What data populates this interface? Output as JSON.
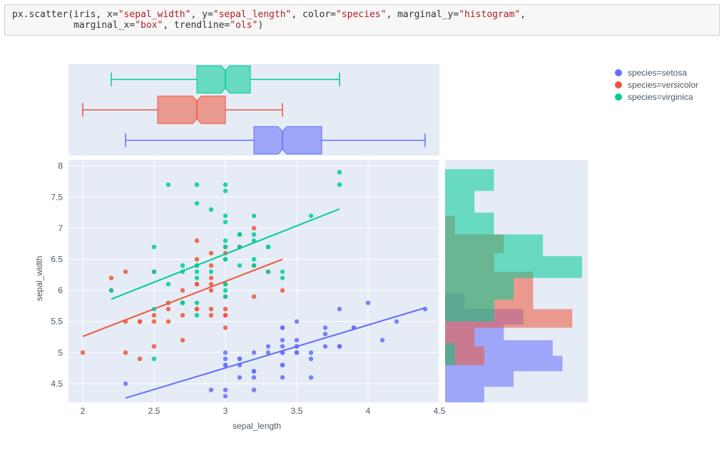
{
  "code_cell": {
    "tokens": [
      {
        "t": "px.scatter(iris, x=",
        "cls": "fn"
      },
      {
        "t": "\"sepal_width\"",
        "cls": "str"
      },
      {
        "t": ", y=",
        "cls": "fn"
      },
      {
        "t": "\"sepal_length\"",
        "cls": "str"
      },
      {
        "t": ", color=",
        "cls": "fn"
      },
      {
        "t": "\"species\"",
        "cls": "str"
      },
      {
        "t": ", marginal_y=",
        "cls": "fn"
      },
      {
        "t": "\"histogram\"",
        "cls": "str"
      },
      {
        "t": ",\n           marginal_x=",
        "cls": "fn"
      },
      {
        "t": "\"box\"",
        "cls": "str"
      },
      {
        "t": ", trendline=",
        "cls": "fn"
      },
      {
        "t": "\"ols\"",
        "cls": "str"
      },
      {
        "t": ")",
        "cls": "fn"
      }
    ]
  },
  "legend": {
    "items": [
      {
        "label": "species=setosa",
        "color": "#636efa"
      },
      {
        "label": "species=versicolor",
        "color": "#EF553B"
      },
      {
        "label": "species=virginica",
        "color": "#00cc96"
      }
    ]
  },
  "axes": {
    "xlabel": "sepal_length",
    "ylabel": "sepal_width",
    "xticks": [
      2,
      2.5,
      3,
      3.5,
      4,
      4.5
    ],
    "yticks": [
      4.5,
      5,
      5.5,
      6,
      6.5,
      7,
      7.5,
      8
    ],
    "xlim": [
      1.9,
      4.5
    ],
    "ylim": [
      4.2,
      8.1
    ]
  },
  "colors": {
    "setosa": "#636efa",
    "versicolor": "#EF553B",
    "virginica": "#00cc96"
  },
  "chart_data": {
    "type": "scatter",
    "xlabel": "sepal_width",
    "ylabel": "sepal_length",
    "series": [
      {
        "name": "setosa",
        "color": "#636efa",
        "points": [
          [
            3.5,
            5.1
          ],
          [
            3.0,
            4.9
          ],
          [
            3.2,
            4.7
          ],
          [
            3.1,
            4.6
          ],
          [
            3.6,
            5.0
          ],
          [
            3.9,
            5.4
          ],
          [
            3.4,
            4.6
          ],
          [
            3.4,
            5.0
          ],
          [
            2.9,
            4.4
          ],
          [
            3.1,
            4.9
          ],
          [
            3.7,
            5.4
          ],
          [
            3.4,
            4.8
          ],
          [
            3.0,
            4.8
          ],
          [
            3.0,
            4.3
          ],
          [
            4.0,
            5.8
          ],
          [
            4.4,
            5.7
          ],
          [
            3.9,
            5.4
          ],
          [
            3.5,
            5.1
          ],
          [
            3.8,
            5.7
          ],
          [
            3.8,
            5.1
          ],
          [
            3.4,
            5.4
          ],
          [
            3.7,
            5.1
          ],
          [
            3.6,
            4.6
          ],
          [
            3.3,
            5.1
          ],
          [
            3.4,
            4.8
          ],
          [
            3.0,
            5.0
          ],
          [
            3.4,
            5.0
          ],
          [
            3.5,
            5.2
          ],
          [
            3.4,
            5.2
          ],
          [
            3.2,
            4.7
          ],
          [
            3.1,
            4.8
          ],
          [
            3.4,
            5.4
          ],
          [
            4.1,
            5.2
          ],
          [
            4.2,
            5.5
          ],
          [
            3.1,
            4.9
          ],
          [
            3.2,
            5.0
          ],
          [
            3.5,
            5.5
          ],
          [
            3.6,
            4.9
          ],
          [
            3.0,
            4.4
          ],
          [
            3.4,
            5.1
          ],
          [
            3.5,
            5.0
          ],
          [
            2.3,
            4.5
          ],
          [
            3.2,
            4.4
          ],
          [
            3.5,
            5.0
          ],
          [
            3.8,
            5.1
          ],
          [
            3.0,
            4.8
          ],
          [
            3.8,
            5.1
          ],
          [
            3.2,
            4.6
          ],
          [
            3.7,
            5.3
          ],
          [
            3.3,
            5.0
          ]
        ],
        "trend": {
          "x0": 2.3,
          "y0": 4.27,
          "x1": 4.4,
          "y1": 5.72
        },
        "box": {
          "min": 2.3,
          "q1": 3.2,
          "med": 3.4,
          "q3": 3.675,
          "max": 4.4
        },
        "hist": {
          "bin_edges": [
            4.2,
            4.45,
            4.7,
            4.95,
            5.2,
            5.45,
            5.7,
            5.95
          ],
          "counts": [
            4,
            7,
            12,
            11,
            6,
            8,
            2
          ]
        }
      },
      {
        "name": "versicolor",
        "color": "#EF553B",
        "points": [
          [
            3.2,
            7.0
          ],
          [
            3.2,
            6.4
          ],
          [
            3.1,
            6.9
          ],
          [
            2.3,
            5.5
          ],
          [
            2.8,
            6.5
          ],
          [
            2.8,
            5.7
          ],
          [
            3.3,
            6.3
          ],
          [
            2.4,
            4.9
          ],
          [
            2.9,
            6.6
          ],
          [
            2.7,
            5.2
          ],
          [
            2.0,
            5.0
          ],
          [
            3.0,
            5.9
          ],
          [
            2.2,
            6.0
          ],
          [
            2.9,
            6.1
          ],
          [
            2.9,
            5.6
          ],
          [
            3.1,
            6.7
          ],
          [
            3.0,
            5.6
          ],
          [
            2.7,
            5.8
          ],
          [
            2.2,
            6.2
          ],
          [
            2.5,
            5.6
          ],
          [
            3.2,
            5.9
          ],
          [
            2.8,
            6.1
          ],
          [
            2.5,
            6.3
          ],
          [
            2.8,
            6.1
          ],
          [
            2.9,
            6.4
          ],
          [
            3.0,
            6.6
          ],
          [
            2.8,
            6.8
          ],
          [
            3.0,
            6.7
          ],
          [
            2.9,
            6.0
          ],
          [
            2.6,
            5.7
          ],
          [
            2.4,
            5.5
          ],
          [
            2.4,
            5.5
          ],
          [
            2.7,
            5.8
          ],
          [
            2.7,
            6.0
          ],
          [
            3.0,
            5.4
          ],
          [
            3.4,
            6.0
          ],
          [
            3.1,
            6.7
          ],
          [
            2.3,
            6.3
          ],
          [
            3.0,
            5.6
          ],
          [
            2.5,
            5.5
          ],
          [
            2.6,
            5.5
          ],
          [
            3.0,
            6.1
          ],
          [
            2.6,
            5.8
          ],
          [
            2.3,
            5.0
          ],
          [
            2.7,
            5.6
          ],
          [
            3.0,
            5.7
          ],
          [
            2.9,
            5.7
          ],
          [
            2.9,
            6.2
          ],
          [
            2.5,
            5.1
          ],
          [
            2.8,
            5.7
          ]
        ],
        "trend": {
          "x0": 2.0,
          "y0": 5.26,
          "x1": 3.4,
          "y1": 6.5
        },
        "box": {
          "min": 2.0,
          "q1": 2.525,
          "med": 2.8,
          "q3": 3.0,
          "max": 3.4
        },
        "hist": {
          "bin_edges": [
            4.8,
            5.1,
            5.4,
            5.7,
            6.0,
            6.3,
            6.6,
            6.9,
            7.2
          ],
          "counts": [
            4,
            3,
            13,
            9,
            9,
            5,
            6,
            1
          ]
        }
      },
      {
        "name": "virginica",
        "color": "#00cc96",
        "points": [
          [
            3.3,
            6.3
          ],
          [
            2.7,
            5.8
          ],
          [
            3.0,
            7.1
          ],
          [
            2.9,
            6.3
          ],
          [
            3.0,
            6.5
          ],
          [
            3.0,
            7.6
          ],
          [
            2.5,
            4.9
          ],
          [
            2.9,
            7.3
          ],
          [
            2.5,
            6.7
          ],
          [
            3.6,
            7.2
          ],
          [
            3.2,
            6.5
          ],
          [
            2.7,
            6.4
          ],
          [
            3.0,
            6.8
          ],
          [
            2.5,
            5.7
          ],
          [
            2.8,
            5.8
          ],
          [
            3.2,
            6.4
          ],
          [
            3.0,
            6.5
          ],
          [
            3.8,
            7.7
          ],
          [
            2.6,
            7.7
          ],
          [
            2.2,
            6.0
          ],
          [
            3.2,
            6.9
          ],
          [
            2.8,
            5.6
          ],
          [
            2.8,
            7.7
          ],
          [
            2.7,
            6.3
          ],
          [
            3.3,
            6.7
          ],
          [
            3.2,
            7.2
          ],
          [
            2.8,
            6.2
          ],
          [
            3.0,
            6.1
          ],
          [
            2.8,
            6.4
          ],
          [
            3.0,
            7.2
          ],
          [
            2.8,
            7.4
          ],
          [
            3.8,
            7.9
          ],
          [
            2.8,
            6.4
          ],
          [
            2.8,
            6.3
          ],
          [
            2.6,
            6.1
          ],
          [
            3.0,
            7.7
          ],
          [
            3.4,
            6.3
          ],
          [
            3.1,
            6.4
          ],
          [
            3.0,
            6.0
          ],
          [
            3.1,
            6.9
          ],
          [
            3.1,
            6.7
          ],
          [
            3.1,
            6.9
          ],
          [
            2.7,
            5.8
          ],
          [
            3.2,
            6.8
          ],
          [
            3.3,
            6.7
          ],
          [
            3.0,
            6.7
          ],
          [
            2.5,
            6.3
          ],
          [
            3.0,
            6.5
          ],
          [
            3.4,
            6.2
          ],
          [
            3.0,
            5.9
          ]
        ],
        "trend": {
          "x0": 2.2,
          "y0": 5.86,
          "x1": 3.8,
          "y1": 7.31
        },
        "box": {
          "min": 2.2,
          "q1": 2.8,
          "med": 3.0,
          "q3": 3.175,
          "max": 3.8
        },
        "hist": {
          "bin_edges": [
            4.8,
            5.15,
            5.5,
            5.85,
            6.2,
            6.55,
            6.9,
            7.25,
            7.6,
            7.95
          ],
          "counts": [
            1,
            0,
            5,
            7,
            14,
            10,
            5,
            3,
            5
          ]
        }
      }
    ],
    "marginal_x": "box",
    "marginal_y": "histogram",
    "trendline": "ols"
  }
}
